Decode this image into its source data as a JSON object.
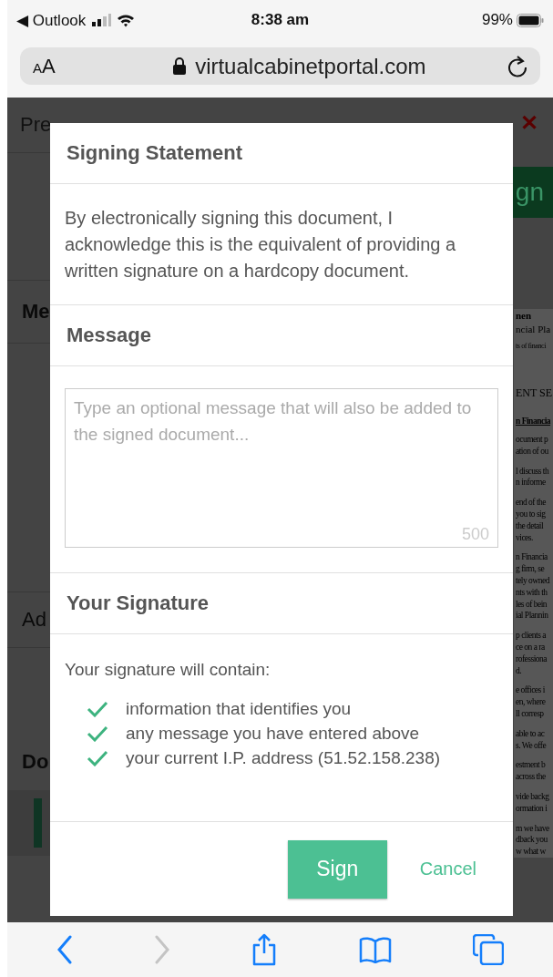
{
  "status_bar": {
    "back_app": "◀ Outlook",
    "time": "8:38 am",
    "battery": "99%"
  },
  "address_bar": {
    "text_size": "AA",
    "url": "virtualcabinetportal.com"
  },
  "background": {
    "title": "Pre",
    "close": "✕",
    "sign_button": "gn",
    "sections": [
      "Me",
      "Ad",
      "Do"
    ],
    "document": {
      "name_lines": [
        "nen",
        "ncial Pla"
      ],
      "tagline": "ts of financi",
      "heading": "ENT SE",
      "subheading": "n Financia",
      "paragraphs": [
        [
          "ocument p",
          "ation of ou"
        ],
        [
          "l discuss th",
          "n informe"
        ],
        [
          "end of the",
          "you to sig",
          "the detail",
          "vices."
        ],
        [
          "n Financia",
          "g firm, se",
          "tely owned",
          "nts with th",
          "les of bein",
          "ial Plannin"
        ],
        [
          "p clients a",
          "ce on a ra",
          "rofessiona",
          "d."
        ],
        [
          "e offices i",
          "en, where",
          "ll corresp"
        ],
        [
          "able to ac",
          "s. We offe"
        ],
        [
          "estment b",
          "across the"
        ],
        [
          "vide backg",
          "ormation i"
        ],
        [
          "m we have",
          "dback you",
          "w what w"
        ]
      ]
    }
  },
  "dialog": {
    "title": "Signing Statement",
    "statement": "By electronically signing this document, I acknowledge this is the equivalent of providing a written signature on a hardcopy document.",
    "message_heading": "Message",
    "message_placeholder": "Type an optional message that will also be added to the signed document...",
    "message_counter": "500",
    "signature_heading": "Your Signature",
    "signature_intro": "Your signature will contain:",
    "signature_items": [
      {
        "text": "information that identifies you",
        "checked": true
      },
      {
        "text": "any message you have entered above",
        "checked": true
      },
      {
        "text": "your current I.P. address (51.52.158.238)",
        "checked": true
      }
    ],
    "buttons": [
      {
        "kind": "primary",
        "label": "Sign"
      },
      {
        "kind": "link",
        "label": "Cancel"
      }
    ]
  },
  "toolbar": {
    "buttons": [
      {
        "kind": "back",
        "disabled": false
      },
      {
        "kind": "forward",
        "disabled": true
      },
      {
        "kind": "share",
        "disabled": false
      },
      {
        "kind": "bookmarks",
        "disabled": false
      },
      {
        "kind": "tabs",
        "disabled": false
      }
    ]
  }
}
